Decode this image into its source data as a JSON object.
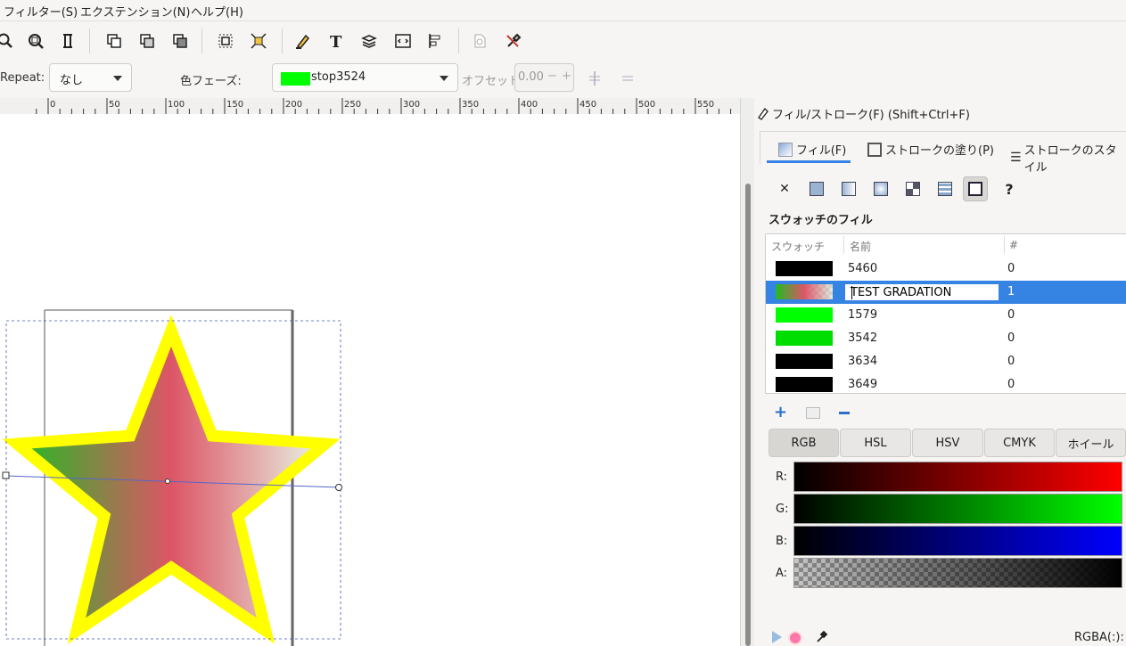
{
  "menu": {
    "items": [
      "フィルター(S)",
      "エクステンション(N)",
      "ヘルプ(H)"
    ]
  },
  "gradient_toolbar": {
    "repeat_label": "Repeat:",
    "repeat_value": "なし",
    "stop_label": "色フェーズ:",
    "stop_value": "stop3524",
    "stop_color": "#00ff00",
    "offset_label": "オフセット:",
    "offset_value": "0.00",
    "minus": "−",
    "plus": "+"
  },
  "ruler": {
    "labels": [
      "0",
      "50",
      "100",
      "150",
      "200",
      "250",
      "300",
      "350",
      "400",
      "450",
      "500",
      "550"
    ]
  },
  "panel": {
    "title": "フィル/ストローク(F) (Shift+Ctrl+F)",
    "tabs": [
      "フィル(F)",
      "ストロークの塗り(P)",
      "ストロークのスタイル"
    ],
    "swatch_heading": "スウォッチのフィル",
    "table": {
      "headers": [
        "スウォッチ",
        "名前",
        "#"
      ],
      "rows": [
        {
          "name": "5460",
          "count": "0",
          "color": "#000000"
        },
        {
          "name": "TEST GRADATION",
          "count": "1",
          "color": "gradient"
        },
        {
          "name": "1579",
          "count": "0",
          "color": "#00ff00"
        },
        {
          "name": "3542",
          "count": "0",
          "color": "#00dd00"
        },
        {
          "name": "3634",
          "count": "0",
          "color": "#000000"
        },
        {
          "name": "3649",
          "count": "0",
          "color": "#000000"
        }
      ]
    },
    "color_modes": [
      "RGB",
      "HSL",
      "HSV",
      "CMYK",
      "ホイール"
    ],
    "channels": [
      "R:",
      "G:",
      "B:",
      "A:"
    ],
    "rgba_label": "RGBA(:):"
  },
  "colors": {
    "accent": "#3584e4",
    "star_stroke": "#ffff00"
  }
}
